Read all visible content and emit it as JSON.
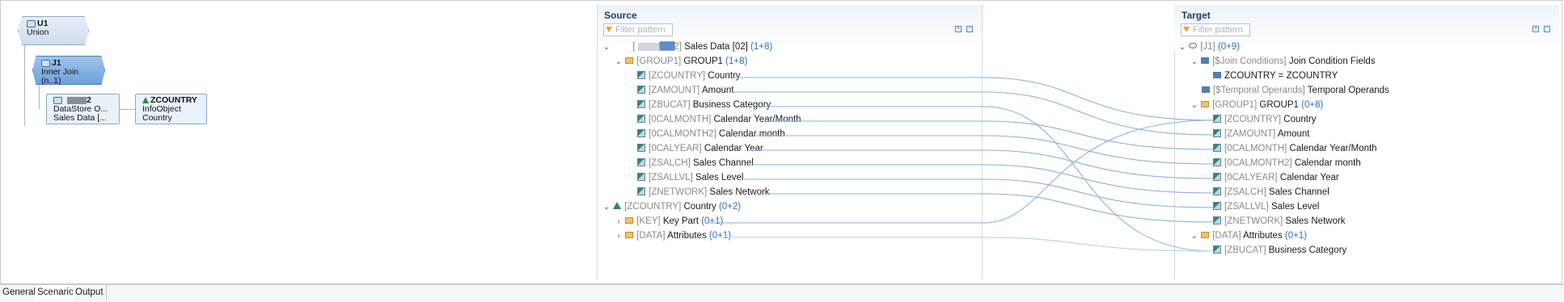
{
  "canvas": {
    "u1": {
      "title": "U1",
      "subtitle": "Union"
    },
    "j1": {
      "title": "J1",
      "line1": "Inner Join",
      "line2": "(n..1)"
    },
    "ds": {
      "title_suffix": "2",
      "line1": "DataStore O...",
      "line2": "Sales Data [..."
    },
    "io": {
      "title": "ZCOUNTRY",
      "line1": "InfoObject",
      "line2": "Country"
    }
  },
  "source": {
    "title": "Source",
    "filter_placeholder": "Filter pattern",
    "rows": [
      {
        "tech": "[",
        "suffix": "2]",
        "label": "Sales Data [02]",
        "count": "(1+8)",
        "blurred": true
      },
      {
        "tech": "[GROUP1]",
        "label": "GROUP1",
        "count": "(1+8)"
      },
      {
        "tech": "[ZCOUNTRY]",
        "label": "Country"
      },
      {
        "tech": "[ZAMOUNT]",
        "label": "Amount"
      },
      {
        "tech": "[ZBUCAT]",
        "label": "Business Category"
      },
      {
        "tech": "[0CALMONTH]",
        "label": "Calendar Year/Month"
      },
      {
        "tech": "[0CALMONTH2]",
        "label": "Calendar month"
      },
      {
        "tech": "[0CALYEAR]",
        "label": "Calendar Year"
      },
      {
        "tech": "[ZSALCH]",
        "label": "Sales Channel"
      },
      {
        "tech": "[ZSALLVL]",
        "label": "Sales Level"
      },
      {
        "tech": "[ZNETWORK]",
        "label": "Sales Network"
      },
      {
        "tech": "[ZCOUNTRY]",
        "label": "Country",
        "count": "(0+2)"
      },
      {
        "tech": "[KEY]",
        "label": "Key Part",
        "count": "(0+1)"
      },
      {
        "tech": "[DATA]",
        "label": "Attributes",
        "count": "(0+1)"
      }
    ]
  },
  "target": {
    "title": "Target",
    "filter_placeholder": "Filter pattern",
    "rows": [
      {
        "tech": "[J1]",
        "label": "",
        "count": "(0+9)"
      },
      {
        "tech": "[$Join Conditions]",
        "label": "Join Condition Fields"
      },
      {
        "tech": "",
        "label": "ZCOUNTRY = ZCOUNTRY"
      },
      {
        "tech": "[$Temporal Operands]",
        "label": "Temporal Operands"
      },
      {
        "tech": "[GROUP1]",
        "label": "GROUP1",
        "count": "(0+8)"
      },
      {
        "tech": "[ZCOUNTRY]",
        "label": "Country"
      },
      {
        "tech": "[ZAMOUNT]",
        "label": "Amount"
      },
      {
        "tech": "[0CALMONTH]",
        "label": "Calendar Year/Month"
      },
      {
        "tech": "[0CALMONTH2]",
        "label": "Calendar month"
      },
      {
        "tech": "[0CALYEAR]",
        "label": "Calendar Year"
      },
      {
        "tech": "[ZSALCH]",
        "label": "Sales Channel"
      },
      {
        "tech": "[ZSALLVL]",
        "label": "Sales Level"
      },
      {
        "tech": "[ZNETWORK]",
        "label": "Sales Network"
      },
      {
        "tech": "[DATA]",
        "label": "Attributes",
        "count": "(0+1)"
      },
      {
        "tech": "[ZBUCAT]",
        "label": "Business Category"
      }
    ]
  },
  "tabs": [
    "General",
    "Scenario",
    "Output"
  ],
  "colors": {
    "accent": "#2f6fbf",
    "line": "#8fb0d6",
    "tech": "#8a8a8a"
  }
}
